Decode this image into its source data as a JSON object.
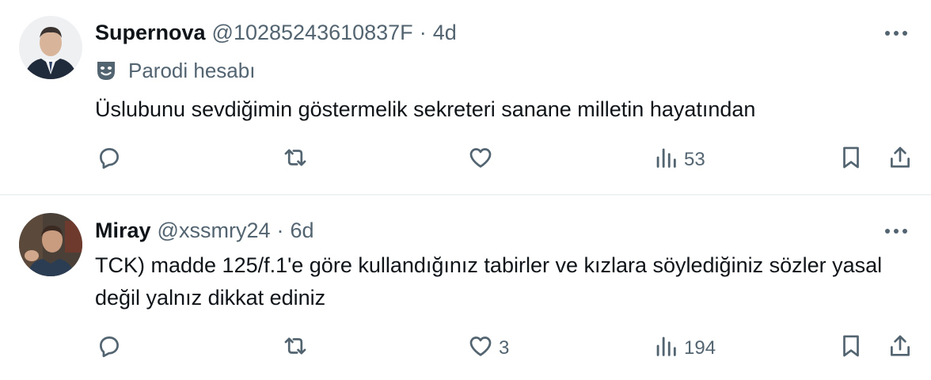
{
  "tweets": [
    {
      "name": "Supernova",
      "handle": "@10285243610837F",
      "separator": "·",
      "time": "4d",
      "badge": "Parodi hesabı",
      "text": "Üslubunu sevdiğimin göstermelik sekreteri sanane milletin hayatından",
      "likes": "",
      "views": "53",
      "avatar_colors": {
        "bg": "#8a9aa6",
        "suit": "#1f2a3a",
        "face": "#d8b59a"
      }
    },
    {
      "name": "Miray",
      "handle": "@xssmry24",
      "separator": "·",
      "time": "6d",
      "text": "TCK) madde 125/f.1'e göre kullandığınız tabirler ve kızlara söylediğiniz sözler yasal değil yalnız dikkat ediniz",
      "likes": "3",
      "views": "194",
      "avatar_colors": {
        "bg": "#4a4037",
        "shirt": "#2b3d52",
        "face": "#c99b7f"
      }
    }
  ],
  "icons": [
    "reply-icon",
    "retweet-icon",
    "like-icon",
    "views-icon",
    "bookmark-icon",
    "share-icon",
    "more-icon",
    "parody-mask-icon"
  ],
  "colors": {
    "text": "#0f1419",
    "secondary": "#536471",
    "divider": "#eff3f4"
  }
}
